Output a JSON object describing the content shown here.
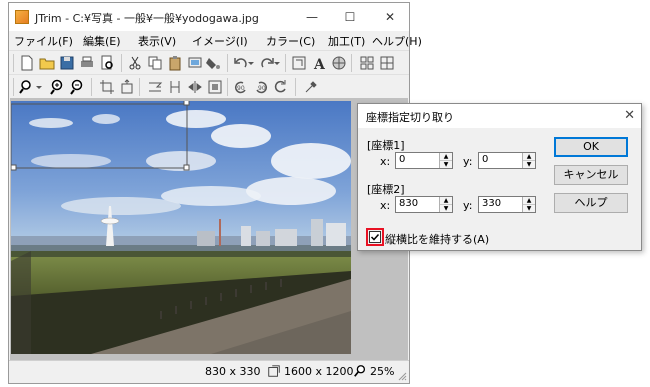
{
  "window": {
    "title": "JTrim - C:¥写真 - 一般¥一般¥yodogawa.jpg",
    "minimize": "—",
    "maximize": "☐",
    "close": "✕"
  },
  "menu": [
    "ファイル(F)",
    "編集(E)",
    "表示(V)",
    "イメージ(I)",
    "カラー(C)",
    "加工(T)",
    "ヘルプ(H)"
  ],
  "status": {
    "selection": "830 x 330",
    "image_size": "1600 x 1200",
    "zoom": "25%"
  },
  "dialog": {
    "title": "座標指定切り取り",
    "close": "✕",
    "group1": "[座標1]",
    "group2": "[座標2]",
    "x_label": "x:",
    "y_label": "y:",
    "x1": "0",
    "y1": "0",
    "x2": "830",
    "y2": "330",
    "checkbox": "縦横比を維持する(A)",
    "checkbox_checked": true,
    "ok": "OK",
    "cancel": "キャンセル",
    "help": "ヘルプ"
  },
  "colors": {
    "accent": "#0078d7",
    "highlight": "#e81123"
  }
}
